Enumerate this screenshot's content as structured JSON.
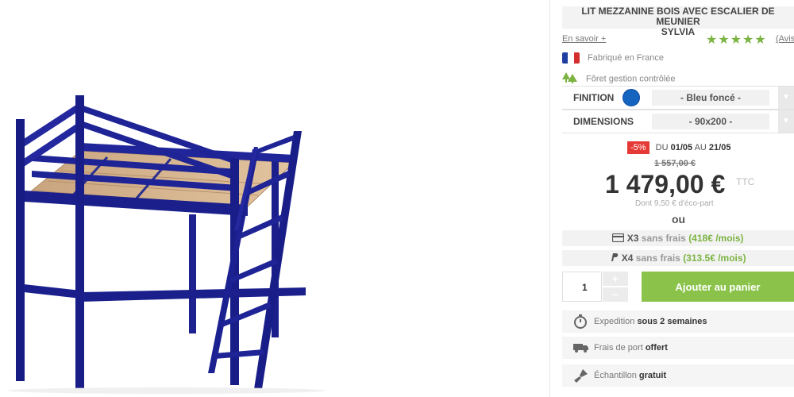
{
  "product": {
    "title_line1": "LIT MEZZANINE BOIS AVEC ESCALIER DE MEUNIER",
    "title_line2": "SYLVIA",
    "learn_more": "En savoir +",
    "rating_stars": 5,
    "reviews_link": "(Avis",
    "features": {
      "made_in": "Fabriqué en France",
      "forest": "Fôret gestion contrôlée"
    },
    "image_alt": "Lit mezzanine bois avec escalier de meunier Sylvia - Bleu foncé"
  },
  "options": {
    "finish": {
      "label": "FINITION",
      "value": "- Bleu foncé -",
      "swatch_color": "#1565c0"
    },
    "dimensions": {
      "label": "DIMENSIONS",
      "value": "- 90x200 -"
    }
  },
  "pricing": {
    "discount_badge": "-5%",
    "promo_du": "DU",
    "promo_start": "01/05",
    "promo_au": "AU",
    "promo_end": "21/05",
    "old_price": "1 557,00 €",
    "price": "1 479,00 €",
    "ttc": "TTC",
    "eco_part": "Dont 9,50 € d'éco-part",
    "ou": "ou",
    "installments": [
      {
        "icon": "card-icon",
        "count": "X3",
        "text": "sans frais",
        "amount": "(418€ /mois)"
      },
      {
        "icon": "paypal-icon",
        "count": "X4",
        "text": "sans frais",
        "amount": "(313.5€ /mois)"
      }
    ]
  },
  "cart": {
    "quantity": "1",
    "plus": "+",
    "minus": "−",
    "add_button": "Ajouter au panier"
  },
  "shipping": {
    "expedition_prefix": "Expedition",
    "expedition_value": "sous 2 semaines",
    "delivery_prefix": "Frais de port",
    "delivery_value": "offert",
    "sample_prefix": "Échantillon",
    "sample_value": "gratuit"
  },
  "colors": {
    "accent_green": "#8bc34a",
    "star_green": "#7cb342",
    "discount_red": "#e53935",
    "bed_blue": "#1a1f8c"
  }
}
